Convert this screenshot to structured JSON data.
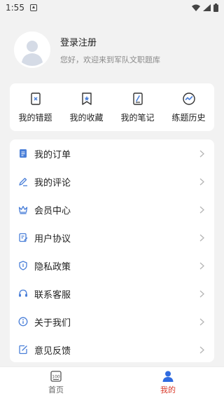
{
  "status_bar": {
    "time": "1:55"
  },
  "profile": {
    "title": "登录注册",
    "subtitle": "您好，欢迎来到军队文职题库"
  },
  "quick_links": [
    {
      "label": "我的错题",
      "icon": "wrong-questions-icon"
    },
    {
      "label": "我的收藏",
      "icon": "favorites-icon"
    },
    {
      "label": "我的笔记",
      "icon": "notes-icon"
    },
    {
      "label": "练题历史",
      "icon": "history-icon"
    }
  ],
  "menu": [
    {
      "label": "我的订单",
      "icon": "order-icon"
    },
    {
      "label": "我的评论",
      "icon": "comment-icon"
    },
    {
      "label": "会员中心",
      "icon": "crown-icon"
    },
    {
      "label": "用户协议",
      "icon": "agreement-icon"
    },
    {
      "label": "隐私政策",
      "icon": "shield-icon"
    },
    {
      "label": "联系客服",
      "icon": "headset-icon"
    },
    {
      "label": "关于我们",
      "icon": "info-icon"
    },
    {
      "label": "意见反馈",
      "icon": "feedback-icon"
    }
  ],
  "bottom_nav": {
    "home": {
      "label": "首页",
      "icon_text": "100"
    },
    "mine": {
      "label": "我的"
    }
  },
  "colors": {
    "accent_blue": "#4a7fd8",
    "active_red": "#d93a2b",
    "background": "#f2f2f2"
  }
}
